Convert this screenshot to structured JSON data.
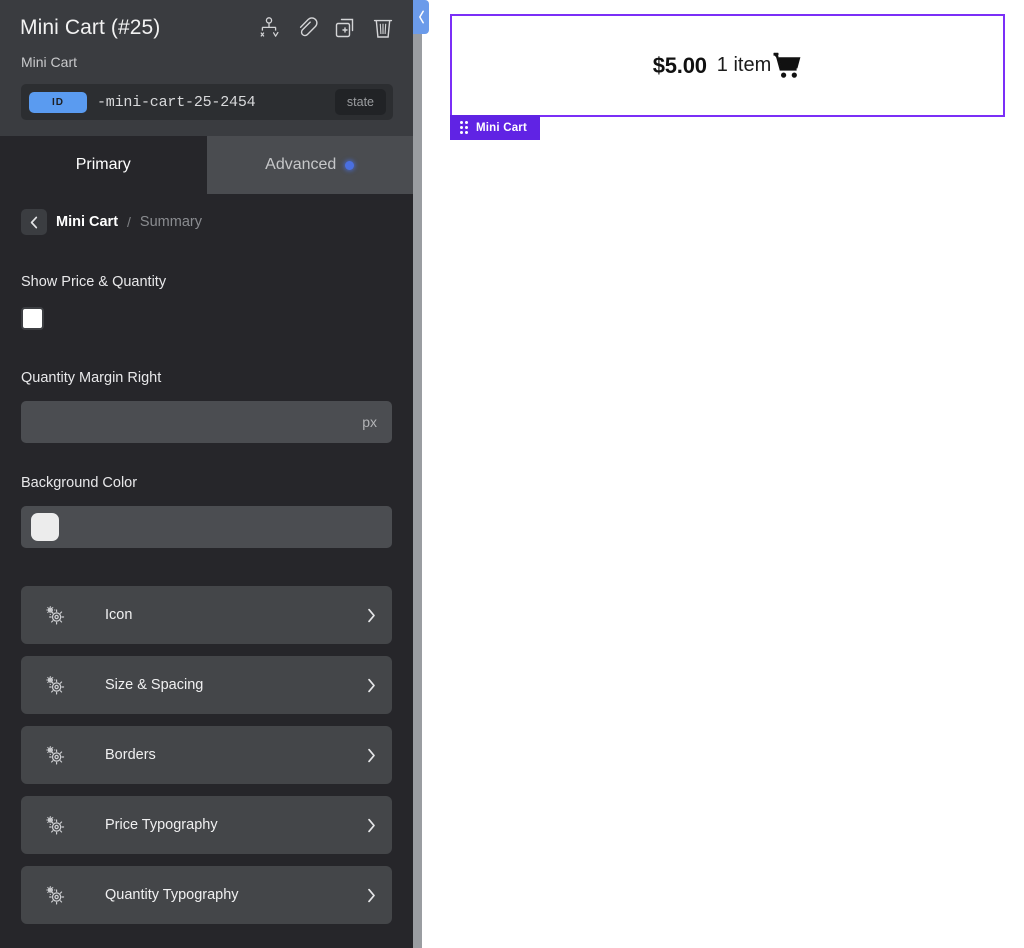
{
  "panel": {
    "title": "Mini Cart (#25)",
    "subtitle": "Mini Cart",
    "id_badge": "ID",
    "id_value": "-mini-cart-25-2454",
    "state_chip": "state",
    "header_icons": [
      {
        "name": "navigator-icon"
      },
      {
        "name": "link-icon"
      },
      {
        "name": "duplicate-icon"
      },
      {
        "name": "delete-icon"
      }
    ],
    "collapse_icon": "chevron-left-icon"
  },
  "tabs": [
    {
      "label": "Primary",
      "active": true,
      "dot": false
    },
    {
      "label": "Advanced",
      "active": false,
      "dot": true
    }
  ],
  "breadcrumb": {
    "back_icon": "chevron-left-icon",
    "current": "Mini Cart",
    "separator": "/",
    "sub": "Summary"
  },
  "controls": {
    "show_price_quantity": {
      "label": "Show Price & Quantity",
      "checked": false
    },
    "quantity_margin_right": {
      "label": "Quantity Margin Right",
      "value": "",
      "unit": "px"
    },
    "background_color": {
      "label": "Background Color",
      "swatch_hex": "#ECECEC",
      "value": ""
    }
  },
  "sections": [
    {
      "label": "Icon",
      "icon": "gear-icon",
      "chevron": "chevron-right-icon"
    },
    {
      "label": "Size & Spacing",
      "icon": "gear-icon",
      "chevron": "chevron-right-icon"
    },
    {
      "label": "Borders",
      "icon": "gear-icon",
      "chevron": "chevron-right-icon"
    },
    {
      "label": "Price Typography",
      "icon": "gear-icon",
      "chevron": "chevron-right-icon"
    },
    {
      "label": "Quantity Typography",
      "icon": "gear-icon",
      "chevron": "chevron-right-icon"
    }
  ],
  "preview": {
    "price": "$5.00",
    "quantity": "1 item",
    "cart_icon": "shopping-cart-icon",
    "widget_tag": "Mini Cart",
    "outline_color": "#7B2FF7",
    "tag_color": "#6023E4"
  }
}
